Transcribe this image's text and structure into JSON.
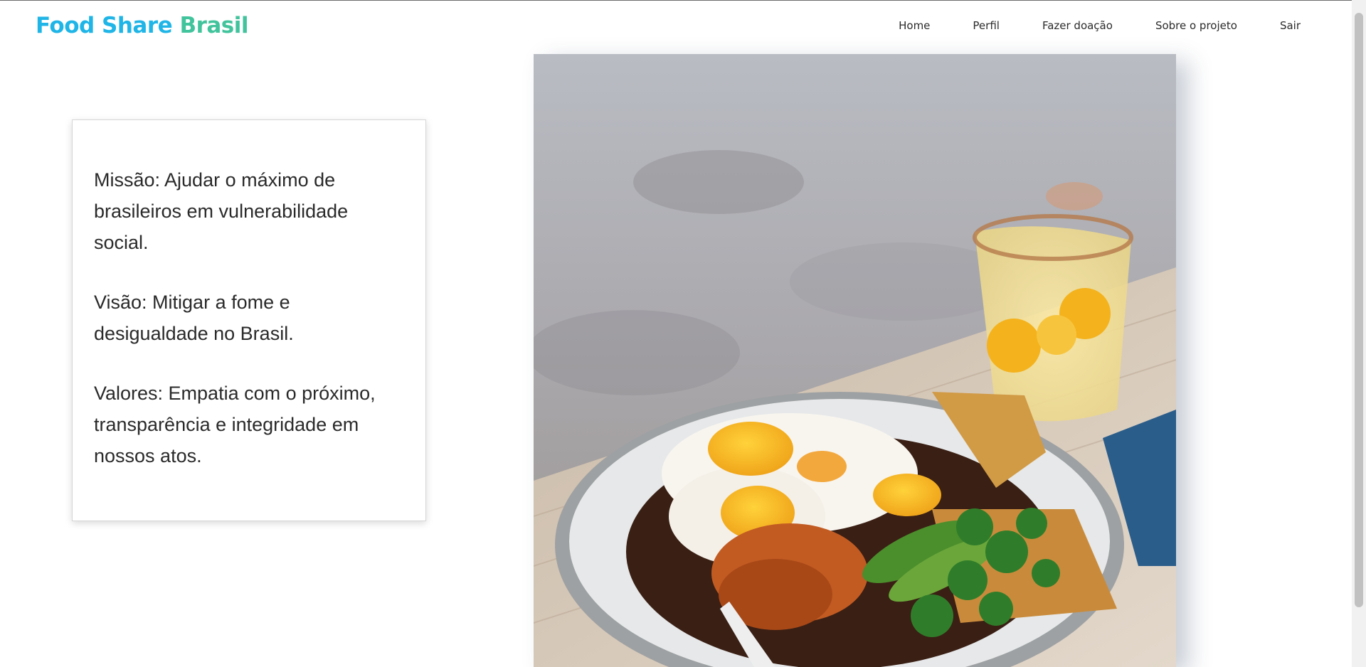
{
  "brand": {
    "part1": "Food Share",
    "part2": "Brasil"
  },
  "nav": {
    "home": "Home",
    "perfil": "Perfil",
    "doacao": "Fazer doação",
    "sobre": "Sobre o projeto",
    "sair": "Sair"
  },
  "about": {
    "missao": "Missão: Ajudar o máximo de brasileiros em vulnerabilidade social.",
    "visao": "Visão: Mitigar a fome e desigualdade no Brasil.",
    "valores": "Valores: Empatia com o próximo, transparência e integridade em nossos atos."
  },
  "colors": {
    "brand_blue": "#1fb5e6",
    "brand_green": "#41c39b",
    "text": "#2a2a2a"
  }
}
